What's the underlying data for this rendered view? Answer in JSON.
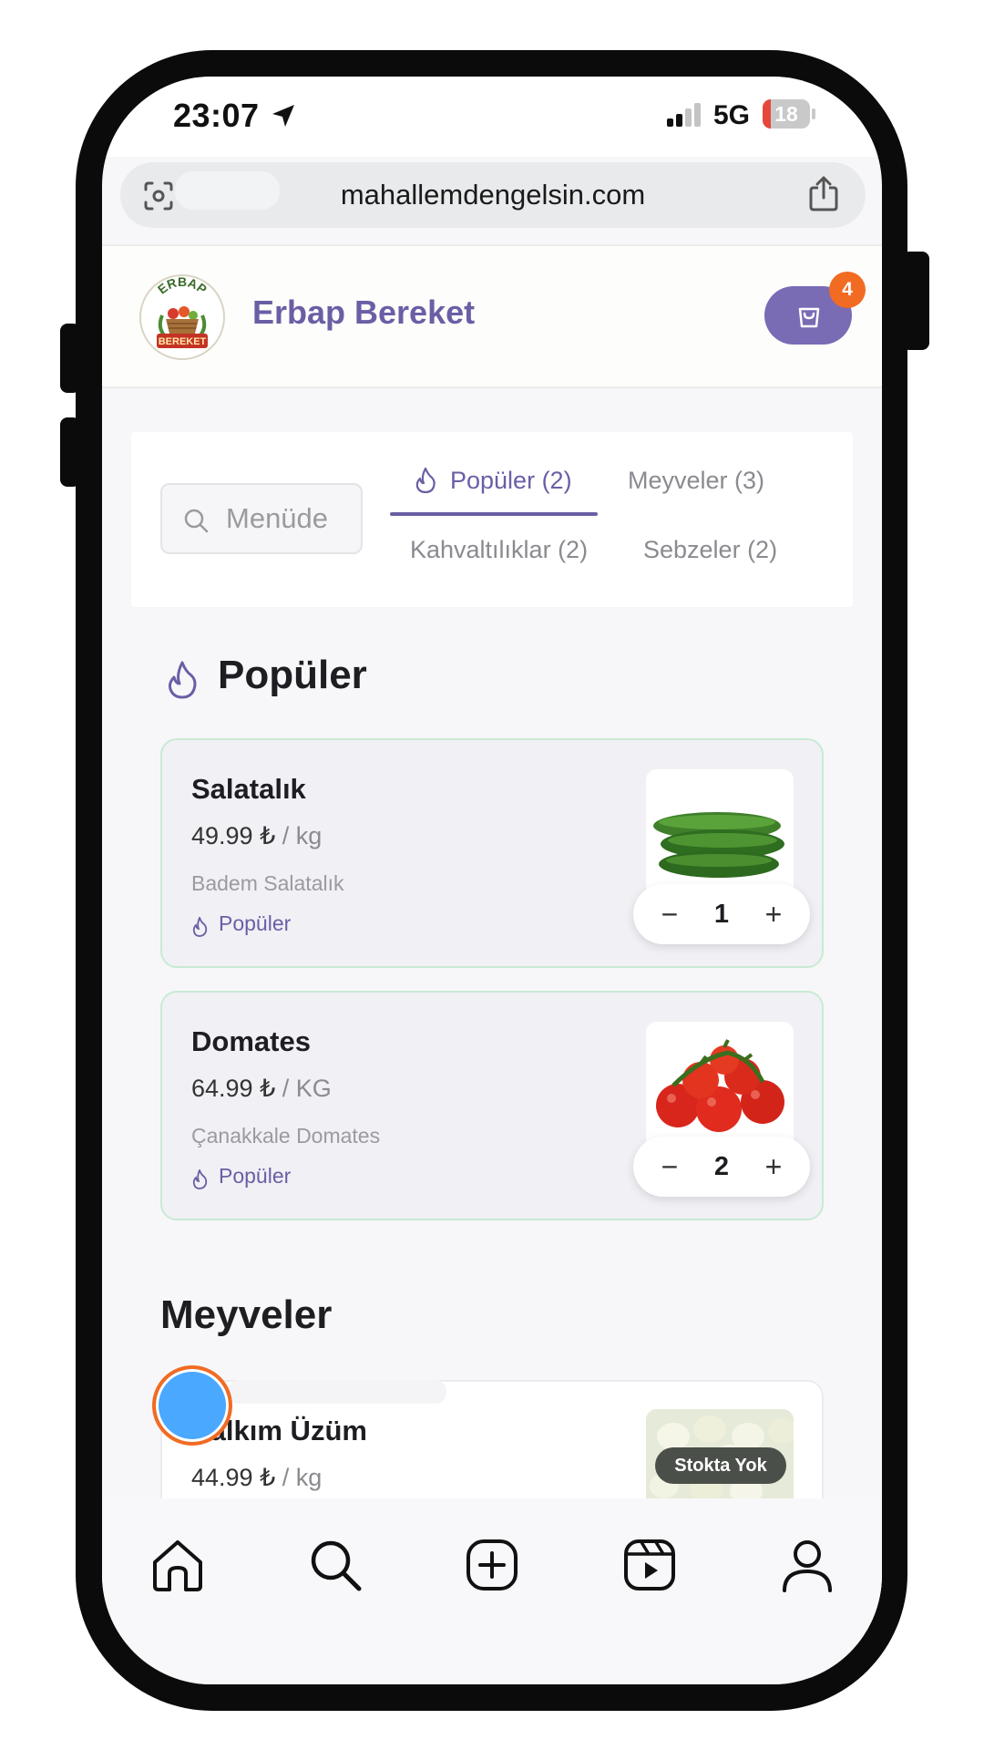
{
  "status_bar": {
    "time": "23:07",
    "network": "5G",
    "battery": "18",
    "battery_level_percent": 18
  },
  "browser": {
    "url": "mahallemdengelsin.com",
    "icons": [
      "reader-mode-icon",
      "share-icon"
    ]
  },
  "header": {
    "logo_text": [
      "ERBAP",
      "BEREKET"
    ],
    "brand": "Erbap Bereket",
    "cart_count": "4"
  },
  "filters": {
    "search_placeholder": "Menüde",
    "tabs": [
      {
        "label": "Popüler (2)",
        "active": true
      },
      {
        "label": "Meyveler (3)",
        "active": false
      },
      {
        "label": "Kahvaltılıklar (2)",
        "active": false
      },
      {
        "label": "Sebzeler (2)",
        "active": false
      }
    ]
  },
  "sections": [
    {
      "title": "Popüler",
      "products": [
        {
          "name": "Salatalık",
          "price": "49.99 ₺",
          "unit": " / kg",
          "description": "Badem Salatalık",
          "tag": "Popüler",
          "quantity": "1",
          "minus": "−",
          "plus": "+"
        },
        {
          "name": "Domates",
          "price": "64.99 ₺",
          "unit": " / KG",
          "description": "Çanakkale Domates",
          "tag": "Popüler",
          "quantity": "2",
          "minus": "−",
          "plus": "+"
        }
      ]
    },
    {
      "title": "Meyveler",
      "products": [
        {
          "name": "Salkım Üzüm",
          "price": "44.99 ₺",
          "unit": " / kg",
          "badge": "Stokta Yok"
        }
      ]
    }
  ],
  "bottom_nav": [
    "home-icon",
    "search-icon",
    "add-icon",
    "reels-icon",
    "profile-icon"
  ],
  "colors": {
    "accent": "#6b5ea5",
    "cart_button": "#7a6bb5",
    "badge": "#f26b22",
    "card_border": "#c8ead3"
  }
}
